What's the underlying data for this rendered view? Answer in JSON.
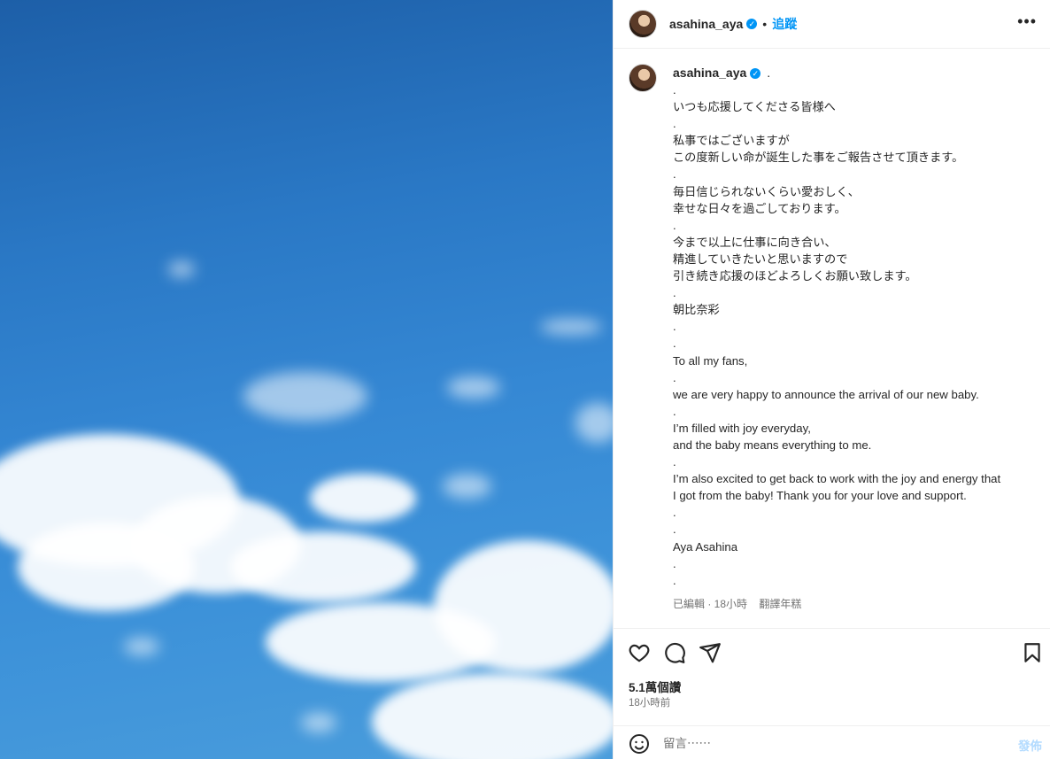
{
  "post": {
    "username": "asahina_aya",
    "verified_mark": "✓",
    "dot_separator": "•",
    "follow_label": "追蹤",
    "more_label": "•••"
  },
  "caption": {
    "username": "asahina_aya",
    "first_line": ".",
    "lines": [
      ".",
      "いつも応援してくださる皆様へ",
      ".",
      "私事ではございますが",
      "この度新しい命が誕生した事をご報告させて頂きます。",
      ".",
      "毎日信じられないくらい愛おしく、",
      "幸せな日々を過ごしております。",
      ".",
      "今まで以上に仕事に向き合い、",
      "精進していきたいと思いますので",
      "引き続き応援のほどよろしくお願い致します。",
      ".",
      "朝比奈彩",
      ".",
      ".",
      "To all my fans,",
      ".",
      "we are very happy to announce the arrival of our new baby.",
      ".",
      "I’m filled with joy everyday,",
      "and the baby means everything to me.",
      ".",
      "I’m also excited to get back to work with the joy and energy that",
      "I got from the baby! Thank you for your love and support.",
      ".",
      ".",
      "Aya Asahina",
      ".",
      "."
    ],
    "meta": "已編輯 · 18小時",
    "translate_label": "翻譯年糕"
  },
  "stats": {
    "views": "5.1萬個讚",
    "time_ago": "18小時前"
  },
  "comment": {
    "placeholder": "留言⋯⋯",
    "post_label": "發佈"
  },
  "icons": {
    "like": "heart-icon",
    "comment": "comment-icon",
    "share": "share-icon",
    "save": "bookmark-icon",
    "emoji": "emoji-icon",
    "more": "more-icon"
  },
  "colors": {
    "accent": "#0095f6",
    "text": "#262626",
    "secondary": "#737373",
    "sky": "#2a78c5"
  }
}
